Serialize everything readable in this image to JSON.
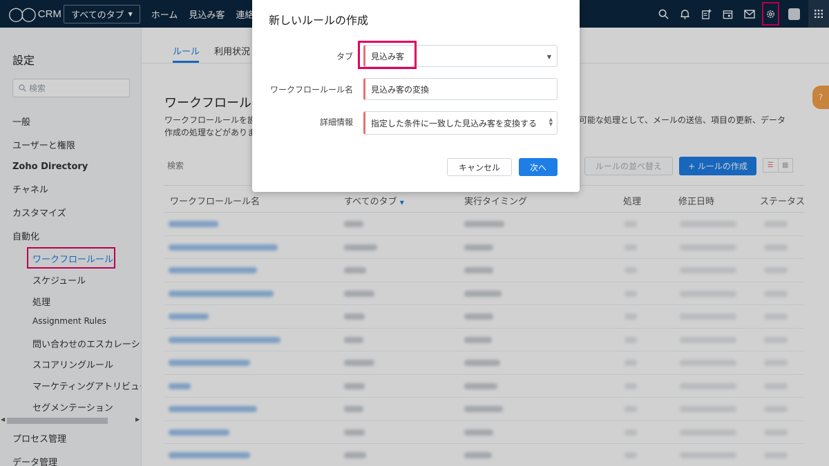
{
  "topbar": {
    "logo_text": "CRM",
    "tabs_dropdown": "すべてのタブ",
    "nav": [
      "ホーム",
      "見込み客",
      "連絡"
    ],
    "icons": [
      "search-icon",
      "bell-icon",
      "add-task-icon",
      "calendar-icon",
      "mail-icon",
      "gear-icon",
      "avatar",
      "apps-grid-icon"
    ]
  },
  "sidebar": {
    "title": "設定",
    "search_placeholder": "検索",
    "items": {
      "general": "一般",
      "users": "ユーザーと権限",
      "zoho_directory": "Zoho Directory",
      "channels": "チャネル",
      "customize": "カスタマイズ",
      "automation": "自動化",
      "process": "プロセス管理",
      "data": "データ管理"
    },
    "automation_sub": {
      "workflow": "ワークフロールール",
      "schedule": "スケジュール",
      "actions": "処理",
      "assignment": "Assignment Rules",
      "escalation": "問い合わせのエスカレーショ",
      "scoring": "スコアリングルール",
      "attribution": "マーケティングアトリビュー",
      "segmentation": "セグメンテーション"
    }
  },
  "main": {
    "tabs": [
      "ルール",
      "利用状況"
    ],
    "page_title": "ワークフロール",
    "desc_line1": "ワークフロールールを設",
    "desc_line2": "作成の処理などがありま",
    "desc_right": "が可能な処理として、メールの送信、項目の更新、データ",
    "search_label": "検索",
    "reorder_button": "ルールの並べ替え",
    "create_button": "+ ルールの作成",
    "columns": {
      "name": "ワークフロールール名",
      "tab": "すべてのタブ",
      "timing": "実行タイミング",
      "action": "処理",
      "modified": "修正日時",
      "status": "ステータス"
    },
    "help_tag": "?"
  },
  "modal": {
    "title": "新しいルールの作成",
    "tab_label": "タブ",
    "tab_value": "見込み客",
    "name_label": "ワークフロールール名",
    "name_value": "見込み客の変換",
    "desc_label": "詳細情報",
    "desc_value": "指定した条件に一致した見込み客を変換する",
    "cancel_button": "キャンセル",
    "next_button": "次へ"
  },
  "colors": {
    "topbar_bg": "#0c2640",
    "accent_blue": "#1e7ee6",
    "highlight_pink": "#e2005f",
    "required_red": "#e87070"
  }
}
